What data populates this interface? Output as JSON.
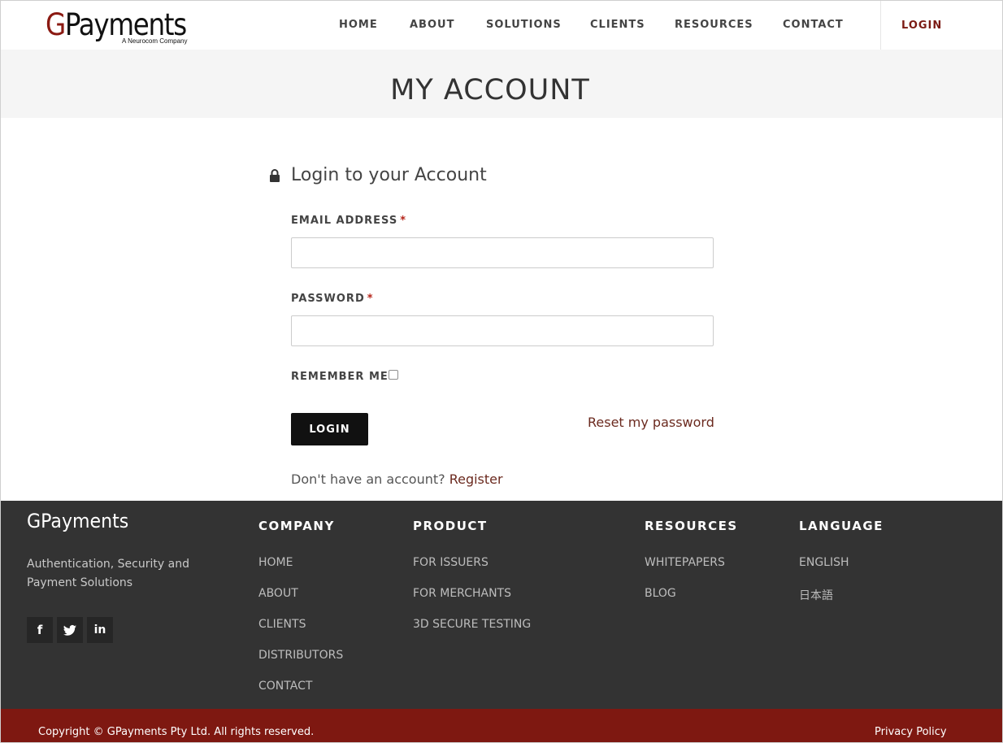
{
  "brand": {
    "logo_g": "G",
    "logo_rest": "Payments",
    "logo_sub": "A Neurocom Company",
    "accent_color": "#7e1811"
  },
  "nav": {
    "items": [
      "HOME",
      "ABOUT",
      "SOLUTIONS",
      "CLIENTS",
      "RESOURCES",
      "CONTACT"
    ],
    "login": "LOGIN"
  },
  "banner": {
    "title": "MY ACCOUNT"
  },
  "login_form": {
    "title": "Login to your Account",
    "lock_icon": "lock-icon",
    "email_label": "EMAIL ADDRESS",
    "email_value": "",
    "password_label": "PASSWORD",
    "password_value": "",
    "required_marker": "*",
    "remember_label": "REMEMBER ME",
    "remember_checked": false,
    "submit_label": "LOGIN",
    "reset_link": "Reset my password",
    "no_account_text": "Don't have an account? ",
    "register_link": "Register"
  },
  "footer": {
    "brand": "GPayments",
    "tagline": "Authentication, Security and Payment Solutions",
    "social": [
      {
        "icon": "facebook-icon",
        "glyph": "f"
      },
      {
        "icon": "twitter-icon",
        "glyph": "t"
      },
      {
        "icon": "linkedin-icon",
        "glyph": "in"
      }
    ],
    "columns": [
      {
        "heading": "COMPANY",
        "links": [
          "HOME",
          "ABOUT",
          "CLIENTS",
          "DISTRIBUTORS",
          "CONTACT"
        ]
      },
      {
        "heading": "PRODUCT",
        "links": [
          "FOR ISSUERS",
          "FOR MERCHANTS",
          "3D SECURE TESTING"
        ]
      },
      {
        "heading": "RESOURCES",
        "links": [
          "WHITEPAPERS",
          "BLOG"
        ]
      },
      {
        "heading": "LANGUAGE",
        "links": [
          "ENGLISH",
          "日本語"
        ]
      }
    ],
    "copyright": "Copyright © GPayments Pty Ltd. All rights reserved.",
    "privacy": "Privacy Policy"
  }
}
